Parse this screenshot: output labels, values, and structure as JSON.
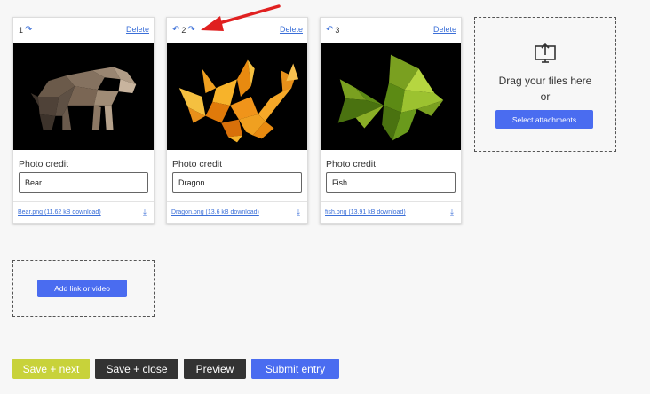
{
  "cards": [
    {
      "order": "1",
      "delete_label": "Delete",
      "credit_label": "Photo credit",
      "credit_value": "Bear",
      "file_link": "Bear.png (11.62 kB download)"
    },
    {
      "order": "2",
      "delete_label": "Delete",
      "credit_label": "Photo credit",
      "credit_value": "Dragon",
      "file_link": "Dragon.png (13.6 kB download)"
    },
    {
      "order": "3",
      "delete_label": "Delete",
      "credit_label": "Photo credit",
      "credit_value": "Fish",
      "file_link": "fish.png (13.91 kB download)"
    }
  ],
  "dropzone": {
    "text_line1": "Drag your files here",
    "text_line2": "or",
    "select_label": "Select attachments"
  },
  "linkzone": {
    "add_label": "Add link or video"
  },
  "footer": {
    "save_next": "Save + next",
    "save_close": "Save + close",
    "preview": "Preview",
    "submit": "Submit entry"
  },
  "colors": {
    "accent_blue": "#4a6cf0",
    "link_blue": "#3b6fd8",
    "save_next_green": "#c8d23a",
    "dark_button": "#333333",
    "annotation_red": "#e02020"
  },
  "icons": {
    "move_left": "undo-arrow-icon",
    "move_right": "redo-arrow-icon",
    "download": "download-icon",
    "upload": "upload-icon"
  }
}
